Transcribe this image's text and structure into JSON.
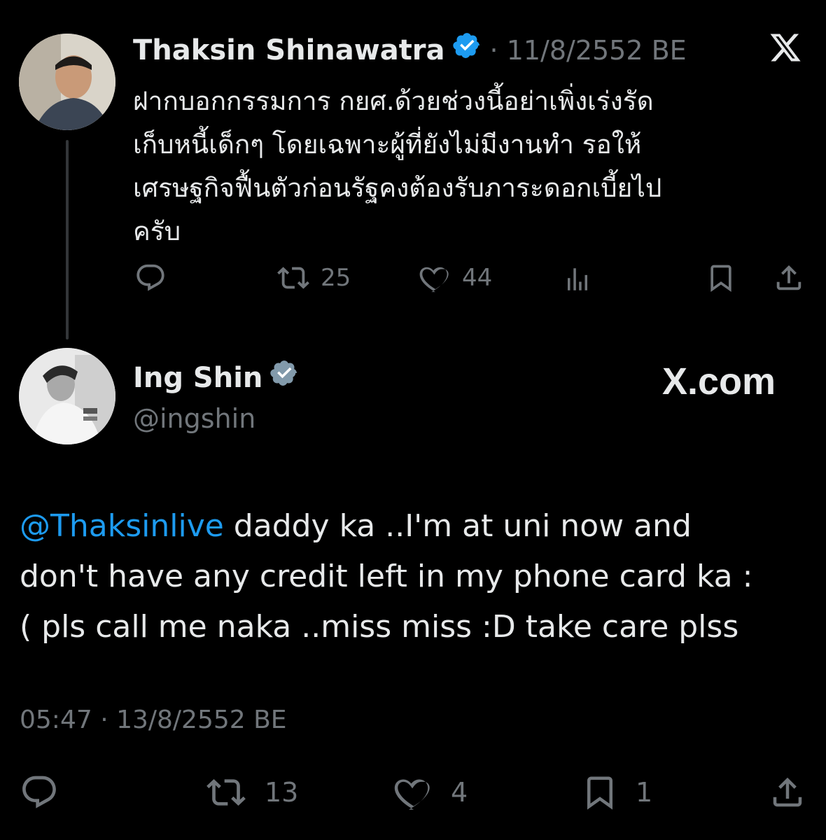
{
  "parent_tweet": {
    "display_name": "Thaksin Shinawatra",
    "date": "· 11/8/2552 BE",
    "text_lines": [
      "ฝากบอกกรรมการ กยศ.ด้วยช่วงนี้อย่าเพิ่งเร่งรัด",
      "เก็บหนี้เด็กๆ โดยเฉพาะผู้ที่ยังไม่มีงานทำ รอให้",
      "เศรษฐกิจฟื้นตัวก่อนรัฐคงต้องรับภาระดอกเบี้ยไป",
      "ครับ"
    ],
    "retweets": "25",
    "likes": "44"
  },
  "reply_tweet": {
    "display_name": "Ing Shin",
    "handle": "@ingshin",
    "mention": "@Thaksinlive",
    "text_line1_rest": " daddy ka ..I'm at uni now and",
    "text_line2": "don't have any credit left in my phone card ka :",
    "text_line3": "( pls call me naka ..miss miss :D take care plss",
    "timestamp": "05:47 · 13/8/2552 BE",
    "retweets": "13",
    "likes": "4",
    "bookmarks": "1"
  },
  "brand": {
    "watermark": "X.com",
    "x_logo": "X"
  },
  "icons": [
    "reply-icon",
    "retweet-icon",
    "like-icon",
    "views-icon",
    "bookmark-icon",
    "share-icon",
    "verified-badge-icon",
    "x-logo-icon"
  ],
  "colors": {
    "background": "#000000",
    "text": "#e7e9ea",
    "muted": "#71767b",
    "link": "#1d9bf0",
    "verified_blue": "#1d9bf0",
    "verified_gray": "#829aab"
  }
}
